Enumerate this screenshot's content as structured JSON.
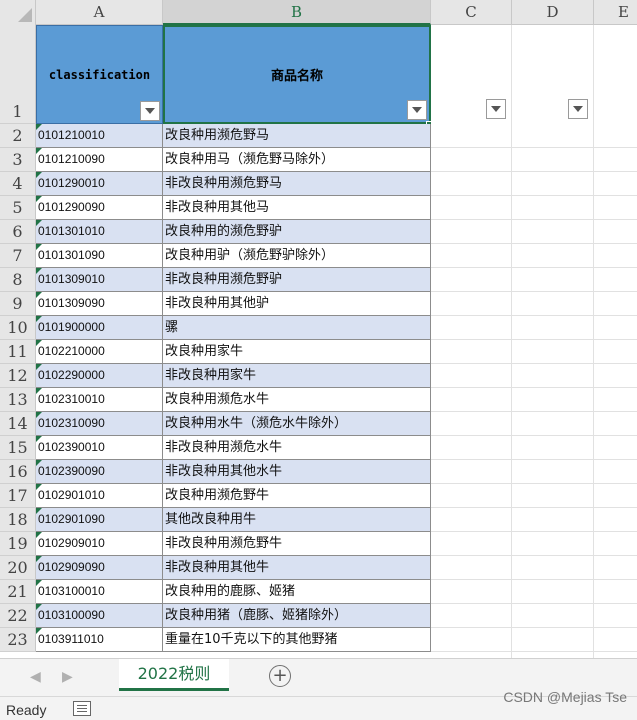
{
  "columns": [
    "A",
    "B",
    "C",
    "D",
    "E"
  ],
  "header": {
    "row_number": "1",
    "a_label": "classification",
    "b_label": "商品名称"
  },
  "rows": [
    {
      "num": "2",
      "code": "0101210010",
      "name": "改良种用濒危野马"
    },
    {
      "num": "3",
      "code": "0101210090",
      "name": "改良种用马（濒危野马除外）"
    },
    {
      "num": "4",
      "code": "0101290010",
      "name": "非改良种用濒危野马"
    },
    {
      "num": "5",
      "code": "0101290090",
      "name": "非改良种用其他马"
    },
    {
      "num": "6",
      "code": "0101301010",
      "name": "改良种用的濒危野驴"
    },
    {
      "num": "7",
      "code": "0101301090",
      "name": "改良种用驴（濒危野驴除外）"
    },
    {
      "num": "8",
      "code": "0101309010",
      "name": "非改良种用濒危野驴"
    },
    {
      "num": "9",
      "code": "0101309090",
      "name": "非改良种用其他驴"
    },
    {
      "num": "10",
      "code": "0101900000",
      "name": "骡"
    },
    {
      "num": "11",
      "code": "0102210000",
      "name": "改良种用家牛"
    },
    {
      "num": "12",
      "code": "0102290000",
      "name": "非改良种用家牛"
    },
    {
      "num": "13",
      "code": "0102310010",
      "name": "改良种用濒危水牛"
    },
    {
      "num": "14",
      "code": "0102310090",
      "name": "改良种用水牛（濒危水牛除外）"
    },
    {
      "num": "15",
      "code": "0102390010",
      "name": "非改良种用濒危水牛"
    },
    {
      "num": "16",
      "code": "0102390090",
      "name": "非改良种用其他水牛"
    },
    {
      "num": "17",
      "code": "0102901010",
      "name": "改良种用濒危野牛"
    },
    {
      "num": "18",
      "code": "0102901090",
      "name": "其他改良种用牛"
    },
    {
      "num": "19",
      "code": "0102909010",
      "name": "非改良种用濒危野牛"
    },
    {
      "num": "20",
      "code": "0102909090",
      "name": "非改良种用其他牛"
    },
    {
      "num": "21",
      "code": "0103100010",
      "name": "改良种用的鹿豚、姬猪"
    },
    {
      "num": "22",
      "code": "0103100090",
      "name": "改良种用猪（鹿豚、姬猪除外）"
    },
    {
      "num": "23",
      "code": "0103911010",
      "name": "重量在10千克以下的其他野猪"
    }
  ],
  "sheet_tab": "2022税则",
  "add_sheet_symbol": "+",
  "status": "Ready",
  "watermark": "CSDN @Mejias Tse",
  "colors": {
    "header_fill": "#5b9bd5",
    "band_fill": "#d9e1f2",
    "accent": "#217346"
  }
}
